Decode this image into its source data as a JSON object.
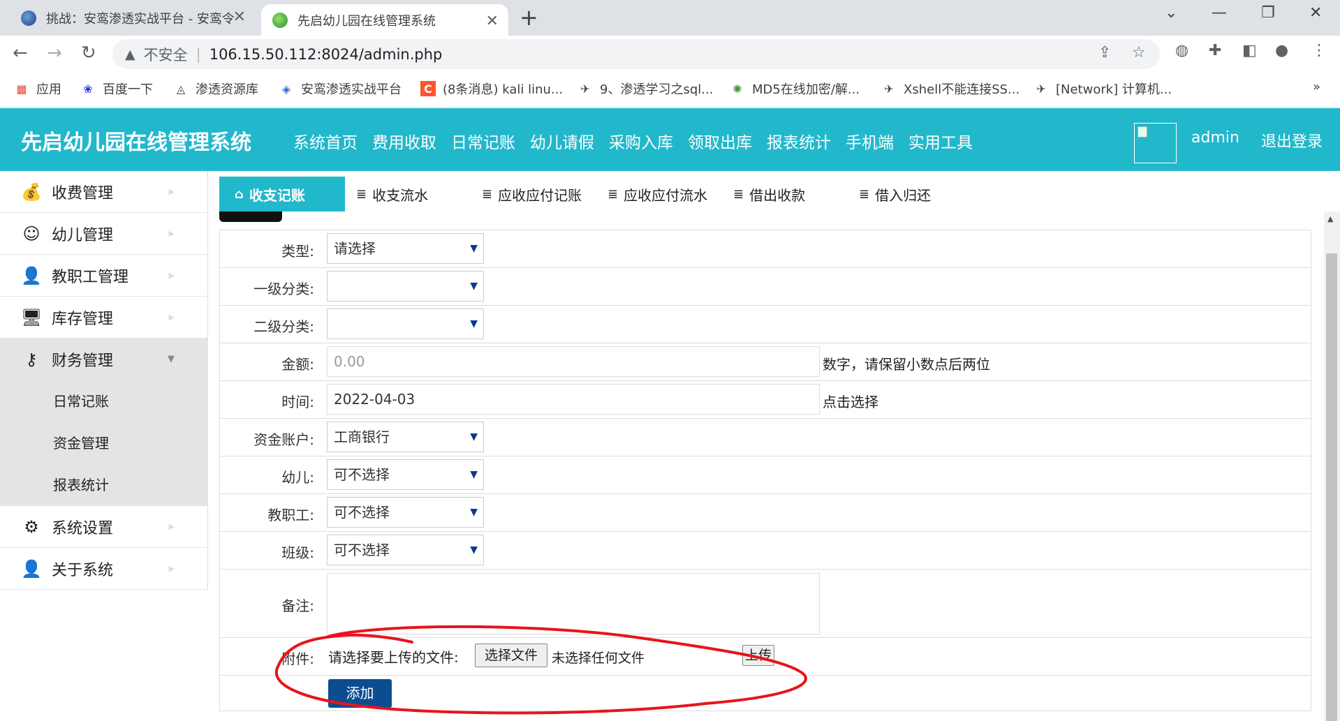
{
  "browser": {
    "tabs": [
      {
        "label": "挑战：安鸾渗透实战平台 - 安鸾令",
        "close": "✕"
      },
      {
        "label": "先启幼儿园在线管理系统",
        "close": "✕"
      }
    ],
    "new_tab": "+",
    "window_controls": {
      "chevron": "⌄",
      "minimize": "—",
      "restore": "❐",
      "close": "✕"
    },
    "nav": {
      "back": "←",
      "forward": "→",
      "reload": "↻"
    },
    "address": {
      "warning_icon": "▲",
      "insecure_label": "不安全",
      "divider": "|",
      "url": "106.15.50.112:8024/admin.php"
    },
    "bookmarks": [
      {
        "label": "应用"
      },
      {
        "label": "百度一下"
      },
      {
        "label": "渗透资源库"
      },
      {
        "label": "安鸾渗透实战平台"
      },
      {
        "label": "(8条消息) kali linu..."
      },
      {
        "label": "9、渗透学习之sql..."
      },
      {
        "label": "MD5在线加密/解..."
      },
      {
        "label": "Xshell不能连接SS..."
      },
      {
        "label": "[Network] 计算机..."
      }
    ],
    "more_bookmarks": "»"
  },
  "app": {
    "title": "先启幼儿园在线管理系统",
    "accent_color": "#22b8cc",
    "top_nav": [
      "系统首页",
      "费用收取",
      "日常记账",
      "幼儿请假",
      "采购入库",
      "领取出库",
      "报表统计",
      "手机端",
      "实用工具"
    ],
    "user": "admin",
    "logout": "退出登录"
  },
  "sidebar": {
    "items": [
      {
        "label": "收费管理",
        "icon": "money-bag-icon",
        "glyph": "💰"
      },
      {
        "label": "幼儿管理",
        "icon": "child-icon",
        "glyph": "☺"
      },
      {
        "label": "教职工管理",
        "icon": "staff-icon",
        "glyph": "👤"
      },
      {
        "label": "库存管理",
        "icon": "monitor-icon",
        "glyph": "🖥"
      },
      {
        "label": "财务管理",
        "icon": "key-icon",
        "glyph": "⚷"
      },
      {
        "label": "系统设置",
        "icon": "gear-icon",
        "glyph": "⚙"
      },
      {
        "label": "关于系统",
        "icon": "user-icon",
        "glyph": "👤"
      }
    ],
    "sub_items": [
      "日常记账",
      "资金管理",
      "报表统计"
    ]
  },
  "subtabs": [
    {
      "label": "收支记账",
      "icon": "home-icon",
      "glyph": "⌂"
    },
    {
      "label": "收支流水",
      "icon": "database-icon",
      "glyph": "≣"
    },
    {
      "label": "应收应付记账",
      "icon": "database-icon",
      "glyph": "≣"
    },
    {
      "label": "应收应付流水",
      "icon": "database-icon",
      "glyph": "≣"
    },
    {
      "label": "借出收款",
      "icon": "database-icon",
      "glyph": "≣"
    },
    {
      "label": "借入归还",
      "icon": "database-icon",
      "glyph": "≣"
    }
  ],
  "form": {
    "type_label": "类型:",
    "type_value": "请选择",
    "cat1_label": "一级分类:",
    "cat1_value": "",
    "cat2_label": "二级分类:",
    "cat2_value": "",
    "amount_label": "金额:",
    "amount_placeholder": "0.00",
    "amount_hint": "数字，请保留小数点后两位",
    "time_label": "时间:",
    "time_value": "2022-04-03",
    "time_hint": "点击选择",
    "account_label": "资金账户:",
    "account_value": "工商银行",
    "child_label": "幼儿:",
    "child_value": "可不选择",
    "staff_label": "教职工:",
    "staff_value": "可不选择",
    "class_label": "班级:",
    "class_value": "可不选择",
    "note_label": "备注:",
    "attach_label": "附件:",
    "upload_prompt": "请选择要上传的文件:",
    "choose_file": "选择文件",
    "no_file": "未选择任何文件",
    "upload": "上传",
    "submit": "添加",
    "caret": "▼"
  },
  "annotation_color": "#e8141c"
}
